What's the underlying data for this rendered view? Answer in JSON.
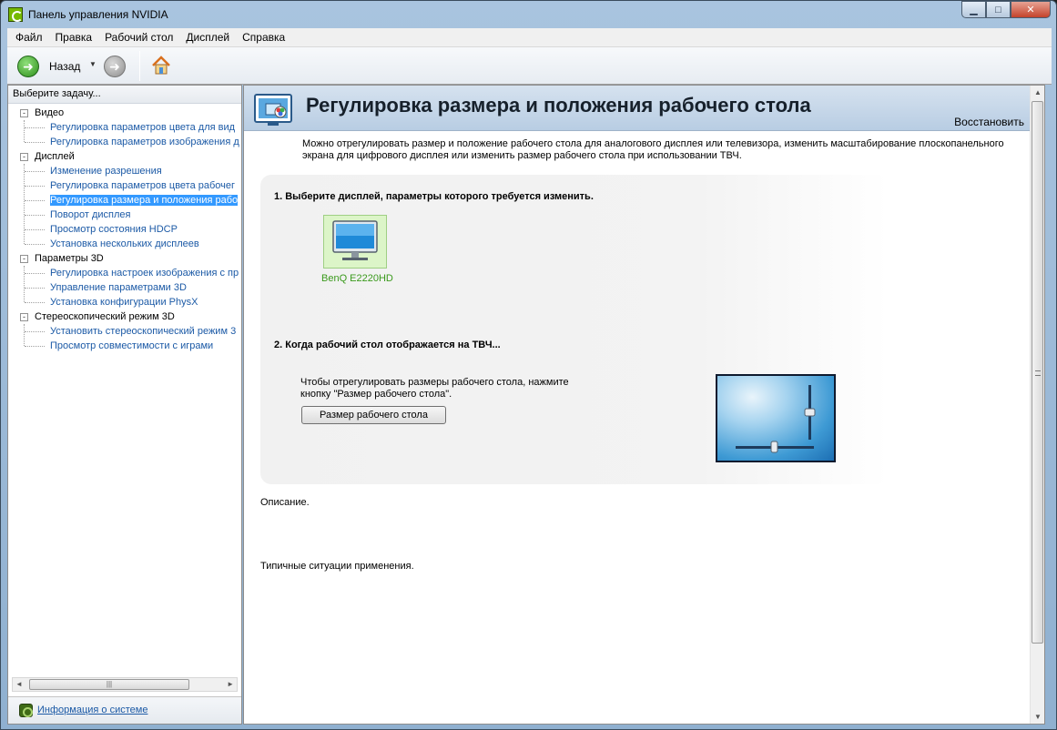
{
  "window": {
    "title": "Панель управления NVIDIA",
    "minimize_glyph": "▁",
    "maximize_glyph": "□",
    "close_glyph": "✕"
  },
  "menu": [
    "Файл",
    "Правка",
    "Рабочий стол",
    "Дисплей",
    "Справка"
  ],
  "toolbar": {
    "back_label": "Назад",
    "back_icon": "arrow-left-circle-icon",
    "forward_icon": "arrow-right-circle-icon",
    "home_icon": "home-icon",
    "dropdown_glyph": "▼"
  },
  "left_pane": {
    "header": "Выберите задачу...",
    "tree": [
      {
        "label": "Видео",
        "expander": "-",
        "items": [
          "Регулировка параметров цвета для вид",
          "Регулировка параметров изображения д"
        ]
      },
      {
        "label": "Дисплей",
        "expander": "-",
        "items": [
          "Изменение разрешения",
          "Регулировка параметров цвета рабочег",
          "Регулировка размера и положения рабо",
          "Поворот дисплея",
          "Просмотр состояния HDCP",
          "Установка нескольких дисплеев"
        ]
      },
      {
        "label": "Параметры 3D",
        "expander": "-",
        "items": [
          "Регулировка настроек изображения с пр",
          "Управление параметрами 3D",
          "Установка конфигурации PhysX"
        ]
      },
      {
        "label": "Стереоскопический режим 3D",
        "expander": "-",
        "items": [
          "Установить стереоскопический режим 3",
          "Просмотр совместимости с играми"
        ]
      }
    ],
    "selected_item": "Регулировка размера и положения рабо",
    "scrollbar_left": "◄",
    "scrollbar_right": "►",
    "scrollbar_grip": "|||",
    "system_info_link": "Информация о системе"
  },
  "page": {
    "title": "Регулировка размера и положения рабочего стола",
    "restore_link": "Восстановить",
    "intro": "Можно отрегулировать размер и положение рабочего стола для аналогового дисплея или телевизора, изменить масштабирование плоскопанельного экрана для цифрового дисплея или изменить размер рабочего стола при использовании ТВЧ.",
    "step1_title": "1. Выберите дисплей, параметры которого требуется изменить.",
    "display_name": "BenQ E2220HD",
    "step2_title": "2. Когда рабочий стол отображается на ТВЧ...",
    "step2_text": "Чтобы отрегулировать размеры рабочего стола, нажмите кнопку \"Размер рабочего стола\".",
    "desktop_size_button": "Размер рабочего стола",
    "description_label": "Описание.",
    "usage_label": "Типичные ситуации применения.",
    "scroll_up": "▲",
    "scroll_down": "▼"
  },
  "colors": {
    "link": "#1c5aa6",
    "selection": "#3399ff",
    "nvidia_green": "#76b900",
    "display_name": "#3a9a1c"
  }
}
